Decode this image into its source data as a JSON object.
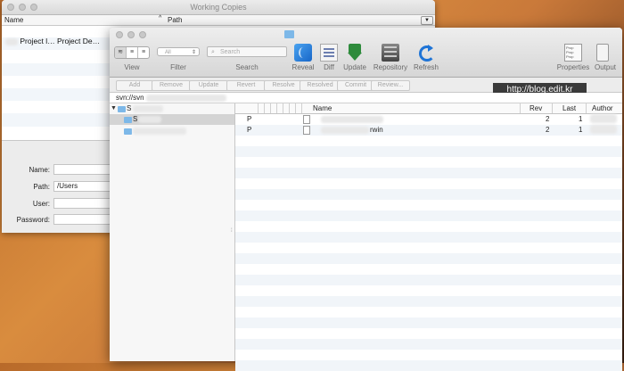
{
  "back_window": {
    "title": "Working Copies",
    "columns": {
      "name": "Name",
      "sort_indicator": "^",
      "path": "Path",
      "menu": "▼"
    },
    "first_row": "Project l… Project De…",
    "form": {
      "name_label": "Name:",
      "path_label": "Path:",
      "path_value": "/Users",
      "user_label": "User:",
      "password_label": "Password:"
    }
  },
  "front_window": {
    "toolbar": {
      "view_label": "View",
      "filter_label": "Filter",
      "filter_value": "All",
      "search_label": "Search",
      "search_placeholder": "Search",
      "reveal_label": "Reveal",
      "diff_label": "Diff",
      "update_label": "Update",
      "repository_label": "Repository",
      "refresh_label": "Refresh",
      "properties_label": "Properties",
      "output_label": "Output"
    },
    "actions": [
      "Add",
      "Remove",
      "Update",
      "Revert",
      "Resolve",
      "Resolved",
      "Commit",
      "Review..."
    ],
    "url": "svn://svn",
    "watermark": "http://blog.edit.kr",
    "sidebar": {
      "root": "S",
      "child": "S"
    },
    "file_columns": {
      "name": "Name",
      "rev": "Rev",
      "last": "Last",
      "author": "Author"
    },
    "files": [
      {
        "status": "P",
        "name": "",
        "rev": "2",
        "last": "1"
      },
      {
        "status": "P",
        "name": "rwin",
        "rev": "2",
        "last": "1"
      }
    ]
  },
  "colors": {
    "accent": "#1f74d6",
    "folder": "#7db8e8",
    "update_green": "#2e8b3c"
  }
}
